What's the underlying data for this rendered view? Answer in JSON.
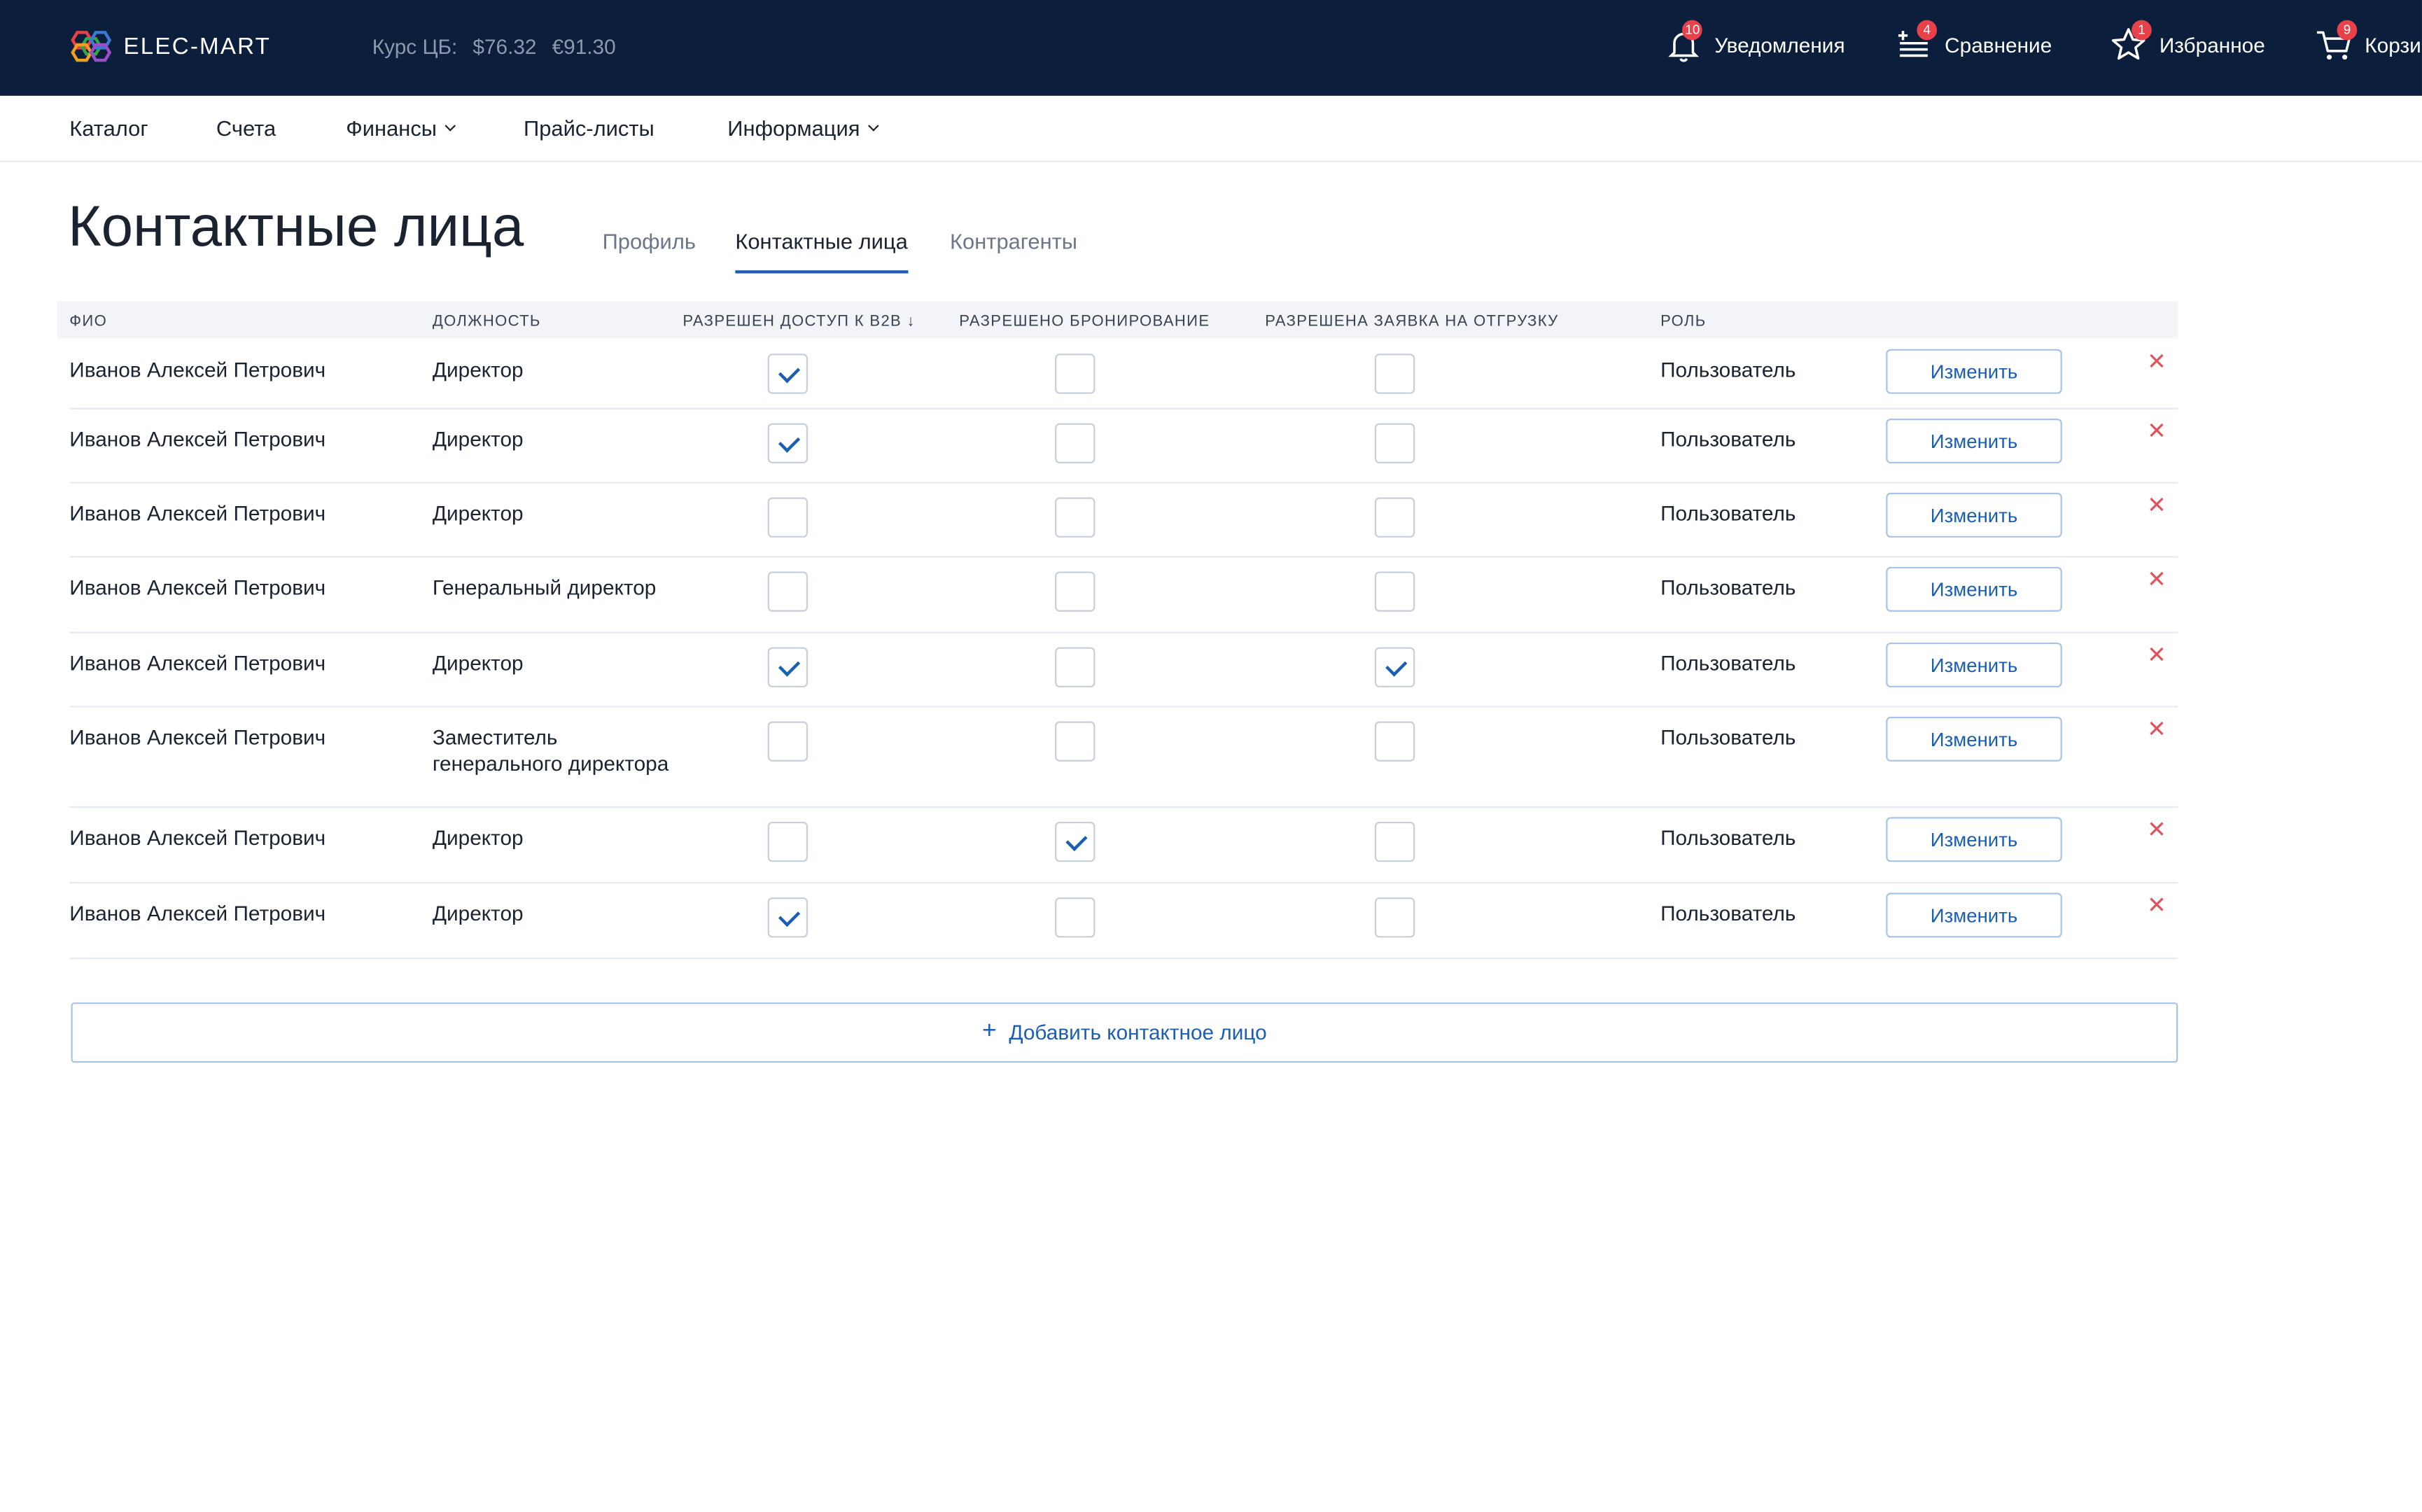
{
  "brand": {
    "name": "ELEC-MART"
  },
  "rates": {
    "label": "Курс ЦБ:",
    "usd": "$76.32",
    "eur": "€91.30"
  },
  "top_actions": [
    {
      "label": "Уведомления",
      "badge": "10",
      "icon": "bell-icon"
    },
    {
      "label": "Сравнение",
      "badge": "4",
      "icon": "compare-list-icon"
    },
    {
      "label": "Избранное",
      "badge": "1",
      "icon": "star-icon"
    },
    {
      "label": "Корзи",
      "badge": "9",
      "icon": "cart-icon"
    }
  ],
  "nav": {
    "items": [
      "Каталог",
      "Счета",
      "Финансы",
      "Прайс-листы",
      "Информация"
    ]
  },
  "page": {
    "title": "Контактные лица"
  },
  "tabs": [
    "Профиль",
    "Контактные лица",
    "Контрагенты"
  ],
  "active_tab": "Контактные лица",
  "table": {
    "headers": [
      "ФИО",
      "ДОЛЖНОСТЬ",
      "РАЗРЕШЕН ДОСТУП К B2B ↓",
      "РАЗРЕШЕНО БРОНИРОВАНИЕ",
      "РАЗРЕШЕНА ЗАЯВКА НА ОТГРУЗКУ",
      "РОЛЬ"
    ],
    "edit_label": "Изменить",
    "delete_symbol": "✕",
    "rows": [
      {
        "name": "Иванов Алексей Петрович",
        "position": "Директор",
        "b2b": true,
        "booking": false,
        "shipment": false,
        "role": "Пользователь"
      },
      {
        "name": "Иванов Алексей Петрович",
        "position": "Директор",
        "b2b": true,
        "booking": false,
        "shipment": false,
        "role": "Пользователь"
      },
      {
        "name": "Иванов Алексей Петрович",
        "position": "Директор",
        "b2b": false,
        "booking": false,
        "shipment": false,
        "role": "Пользователь"
      },
      {
        "name": "Иванов Алексей Петрович",
        "position": "Генеральный директор",
        "b2b": false,
        "booking": false,
        "shipment": false,
        "role": "Пользователь"
      },
      {
        "name": "Иванов Алексей Петрович",
        "position": "Директор",
        "b2b": true,
        "booking": false,
        "shipment": true,
        "role": "Пользователь"
      },
      {
        "name": "Иванов Алексей Петрович",
        "position": "Заместитель",
        "position_line2": "генерального директора",
        "b2b": false,
        "booking": false,
        "shipment": false,
        "role": "Пользователь"
      },
      {
        "name": "Иванов Алексей Петрович",
        "position": "Директор",
        "b2b": false,
        "booking": true,
        "shipment": false,
        "role": "Пользователь"
      },
      {
        "name": "Иванов Алексей Петрович",
        "position": "Директор",
        "b2b": true,
        "booking": false,
        "shipment": false,
        "role": "Пользователь"
      }
    ]
  },
  "add_button": {
    "label": "Добавить контактное лицо",
    "icon": "plus-icon"
  },
  "colors": {
    "topbar": "#0b1e3c",
    "accent": "#1a5fb4",
    "delete": "#e0545c",
    "badge": "#e8414a"
  }
}
